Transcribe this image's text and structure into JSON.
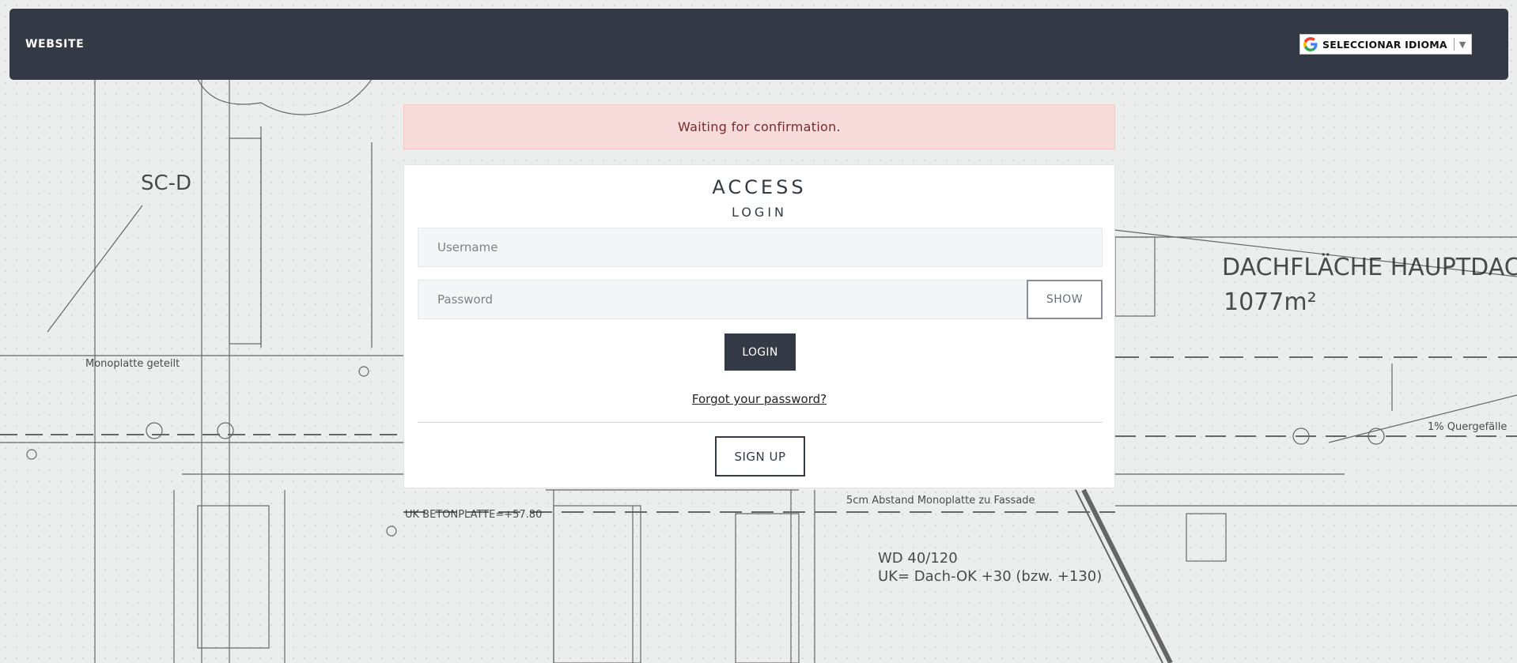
{
  "navbar": {
    "brand": "WEBSITE",
    "language_selector": {
      "label": "SELECCIONAR IDIOMA",
      "arrow": "▼",
      "icon": "google-icon"
    }
  },
  "alert": {
    "message": "Waiting for confirmation."
  },
  "login_card": {
    "title": "ACCESS",
    "subtitle": "LOGIN",
    "username_placeholder": "Username",
    "password_placeholder": "Password",
    "show_label": "SHOW",
    "login_label": "LOGIN",
    "forgot_label": "Forgot your password?",
    "signup_label": "SIGN UP"
  },
  "background_labels": {
    "label_1": "SC-D",
    "label_2": "DACHFLÄCHE HAUPTDACH",
    "label_3": "1077m²",
    "label_4": "WD 40/120",
    "label_5": "UK= Dach-OK +30 (bzw. +130)",
    "label_6": "UK BETONPLATTE=+57.80",
    "label_7": "Monoplatte geteilt",
    "label_8": "5cm Abstand Monoplatte zu Fassade",
    "label_9": "1% Quergefälle"
  },
  "colors": {
    "navbar_bg": "#343a45",
    "alert_bg": "#f8dcdc",
    "alert_text": "#7a2a2a",
    "primary": "#343a45"
  }
}
